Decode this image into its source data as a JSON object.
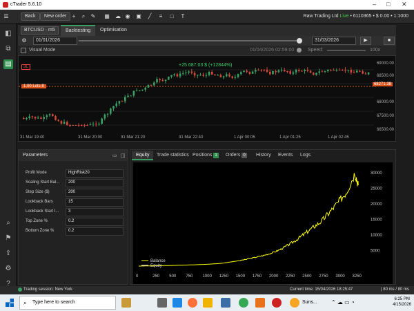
{
  "window": {
    "title": "cTrader 5.6.10"
  },
  "toolbar": {
    "back": "Back",
    "new_order": "New order",
    "account": "Raw Trading Ltd",
    "live": "Live",
    "account_info": "• 6110365 • $ 0.00 • 1:1000"
  },
  "tabs": {
    "symbol": "BTCUSD · m5",
    "items": [
      "Backtesting",
      "Optimisation"
    ]
  },
  "dates": {
    "start": "01/01/2026",
    "end": "31/03/2026"
  },
  "visual": {
    "label": "Visual Mode",
    "time": "01/04/2026 02:59:00",
    "speed_label": "Speed:",
    "speed": "100x"
  },
  "chart": {
    "pnl": "+25 687.03 $ (+12844%)",
    "lots": "1.00 Lots 8",
    "symbol_tag": "3L",
    "price_tag": "68271.38",
    "price_labels": [
      "69000.00",
      "68500.00",
      "68000.00",
      "67500.00",
      "67000.00",
      "66500.00"
    ],
    "time_labels": [
      "31 Mar 19:40",
      "31 Mar 20:00",
      "31 Mar 21:20",
      "31 Mar 22:40",
      "1 Apr 00:05",
      "1 Apr 01:25",
      "1 Apr 02:45"
    ]
  },
  "params": {
    "title": "Parameters",
    "rows": [
      {
        "label": "Profit Mode",
        "value": "HighRisk20"
      },
      {
        "label": "Scaling Start Bal...",
        "value": "200"
      },
      {
        "label": "Step Size ($)",
        "value": "200"
      },
      {
        "label": "Lookback Bars",
        "value": "15"
      },
      {
        "label": "Lookback Start I...",
        "value": "3"
      },
      {
        "label": "Top Zone %",
        "value": "0.2"
      },
      {
        "label": "Bottom Zone %",
        "value": "0.2"
      }
    ]
  },
  "eq_tabs": {
    "items": [
      "Equity",
      "Trade statistics",
      "Positions",
      "Orders",
      "History",
      "Events",
      "Logs"
    ],
    "positions_count": "1",
    "orders_count": "0"
  },
  "chart_data": {
    "type": "line",
    "series": [
      {
        "name": "Balance",
        "color": "#ffff00",
        "points": [
          [
            0,
            0
          ],
          [
            250,
            100
          ],
          [
            500,
            200
          ],
          [
            750,
            350
          ],
          [
            1000,
            550
          ],
          [
            1125,
            700
          ],
          [
            1250,
            900
          ],
          [
            1375,
            1300
          ],
          [
            1500,
            1700
          ],
          [
            1625,
            2200
          ],
          [
            1750,
            2800
          ],
          [
            1875,
            3400
          ],
          [
            2000,
            4200
          ],
          [
            2125,
            5300
          ],
          [
            2250,
            6800
          ],
          [
            2375,
            8500
          ],
          [
            2500,
            10500
          ],
          [
            2625,
            12500
          ],
          [
            2750,
            14500
          ],
          [
            2875,
            17500
          ],
          [
            3000,
            20500
          ],
          [
            3125,
            24000
          ],
          [
            3250,
            30000
          ],
          [
            3300,
            26000
          ]
        ]
      },
      {
        "name": "Equity",
        "color": "#ffffff",
        "points": [
          [
            0,
            0
          ],
          [
            3300,
            26000
          ]
        ]
      }
    ],
    "x_ticks": [
      "0",
      "250",
      "500",
      "750",
      "1000",
      "1250",
      "1500",
      "1750",
      "2000",
      "2250",
      "2500",
      "2750",
      "3000",
      "3250"
    ],
    "y_ticks": [
      "5000",
      "10000",
      "15000",
      "20000",
      "25000",
      "30000"
    ],
    "xlim": [
      0,
      3400
    ],
    "ylim": [
      0,
      31500
    ]
  },
  "status": {
    "session": "Trading session: New York",
    "current_time": "Current time: 15/04/2026 18:25:47",
    "latency": "| 80 ms / 80 ms"
  },
  "taskbar": {
    "search": "Type here to search",
    "weather": "Suns...",
    "time": "6:25 PM",
    "date": "4/15/2026"
  }
}
